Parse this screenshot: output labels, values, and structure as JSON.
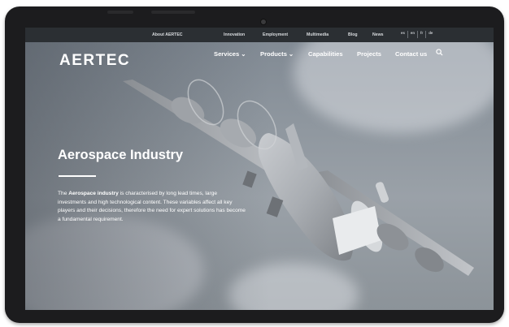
{
  "utility_nav": [
    "About AERTEC",
    "Innovation",
    "Employment",
    "Multimedia",
    "Blog",
    "News"
  ],
  "languages": [
    "es",
    "en",
    "fr",
    "de"
  ],
  "brand": "AERTEC",
  "main_nav": [
    {
      "label": "Services",
      "has_dropdown": true
    },
    {
      "label": "Products",
      "has_dropdown": true
    },
    {
      "label": "Capabilities",
      "has_dropdown": false
    },
    {
      "label": "Projects",
      "has_dropdown": false
    },
    {
      "label": "Contact us",
      "has_dropdown": false
    }
  ],
  "hero": {
    "title": "Aerospace Industry",
    "body_prefix": "The ",
    "body_bold": "Aerospace industry",
    "body_rest": " is characterised by long lead times, large investments and high technological content. These variables affect all key players and their decisions, therefore the need for expert solutions has become a fundamental requirement."
  },
  "icons": {
    "search": "search-icon",
    "dropdown": "chevron-down-icon"
  },
  "colors": {
    "topbar": "#2b2f33",
    "text": "#ffffff",
    "sky": "#8f979f",
    "device": "#1c1c1e"
  }
}
